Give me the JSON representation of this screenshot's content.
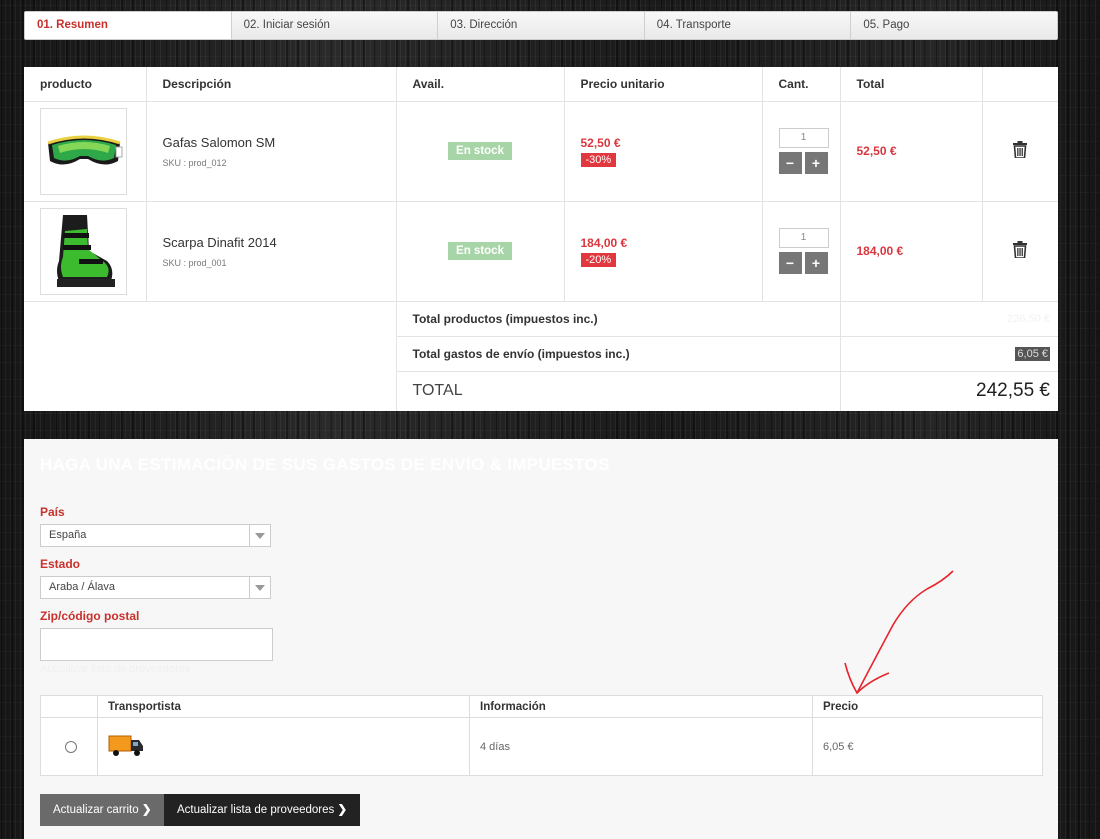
{
  "steps": [
    {
      "label": "01. Resumen"
    },
    {
      "label": "02. Iniciar sesión"
    },
    {
      "label": "03. Dirección"
    },
    {
      "label": "04. Transporte"
    },
    {
      "label": "05. Pago"
    }
  ],
  "cart": {
    "headers": {
      "product": "producto",
      "description": "Descripción",
      "avail": "Avail.",
      "unit_price": "Precio unitario",
      "qty": "Cant.",
      "total": "Total"
    },
    "items": [
      {
        "name": "Gafas Salomon SM",
        "sku": "SKU : prod_012",
        "stock": "En stock",
        "price": "52,50 €",
        "discount": "-30%",
        "qty": "1",
        "total": "52,50 €",
        "image": "ski-goggles-image"
      },
      {
        "name": "Scarpa Dinafit 2014",
        "sku": "SKU : prod_001",
        "stock": "En stock",
        "price": "184,00 €",
        "discount": "-20%",
        "qty": "1",
        "total": "184,00 €",
        "image": "ski-boot-image"
      }
    ],
    "qty_minus": "−",
    "qty_plus": "+",
    "total_products_label": "Total productos (impuestos inc.)",
    "total_products_value": "236,50 €",
    "total_shipping_label": "Total gastos de envío (impuestos inc.)",
    "total_shipping_value": "6,05 €",
    "grand_total_label": "TOTAL",
    "grand_total_value": "242,55 €"
  },
  "estimator": {
    "title": "Haga una estimación de sus gastos de envío & impuestos",
    "country_label": "País",
    "country_value": "España",
    "state_label": "Estado",
    "state_value": "Araba / Álava",
    "zip_label": "Zip/código postal",
    "zip_value": "",
    "faint_link": "Actualizar lista de proveedores",
    "carrier_headers": {
      "carrier": "Transportista",
      "info": "Información",
      "price": "Precio"
    },
    "carriers": [
      {
        "info": "4 días",
        "price": "6,05 €",
        "icon": "truck-icon"
      }
    ],
    "buttons": {
      "update_cart": "Actualizar carrito",
      "update_carriers": "Actualizar lista de proveedores"
    }
  },
  "colors": {
    "accent_red": "#d9363e",
    "stock_green": "#a8d5a8",
    "annotation": "#e8232a"
  }
}
